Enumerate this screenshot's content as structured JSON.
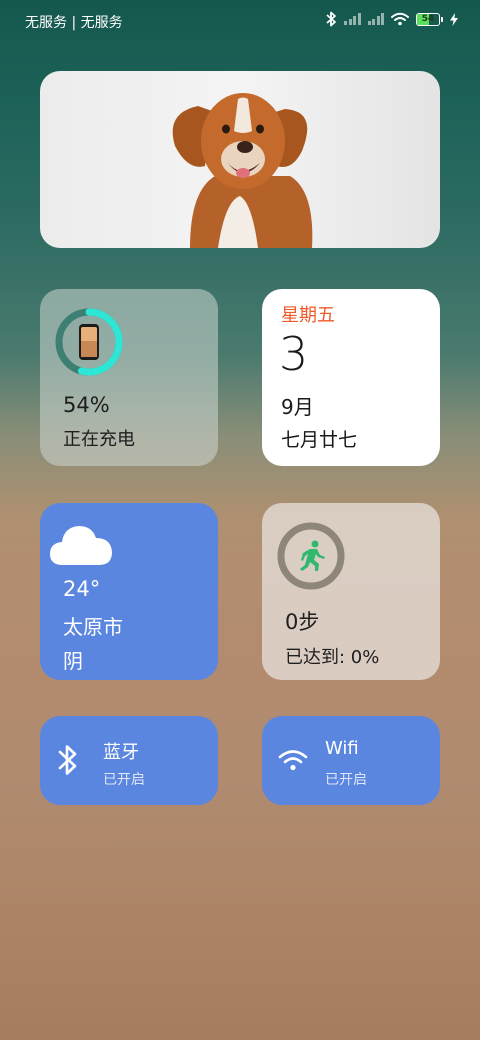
{
  "status_bar": {
    "carrier": "无服务 | 无服务",
    "battery": "54"
  },
  "battery_widget": {
    "level": "54%",
    "status": "正在充电",
    "fraction": 0.54
  },
  "calendar_widget": {
    "weekday": "星期五",
    "day": "3",
    "month": "9月",
    "lunar": "七月廿七"
  },
  "weather_widget": {
    "temperature": "24°",
    "city": "太原市",
    "condition": "阴"
  },
  "steps_widget": {
    "steps": "0步",
    "progress": "已达到: 0%"
  },
  "bluetooth_toggle": {
    "title": "蓝牙",
    "state": "已开启"
  },
  "wifi_toggle": {
    "title": "Wifi",
    "state": "已开启"
  },
  "colors": {
    "accent_blue": "#5b86e0",
    "calendar_weekday": "#f05a28",
    "battery_ring": "#2ee6d6",
    "steps_ring": "#8e8676",
    "runner": "#2fb86e"
  }
}
